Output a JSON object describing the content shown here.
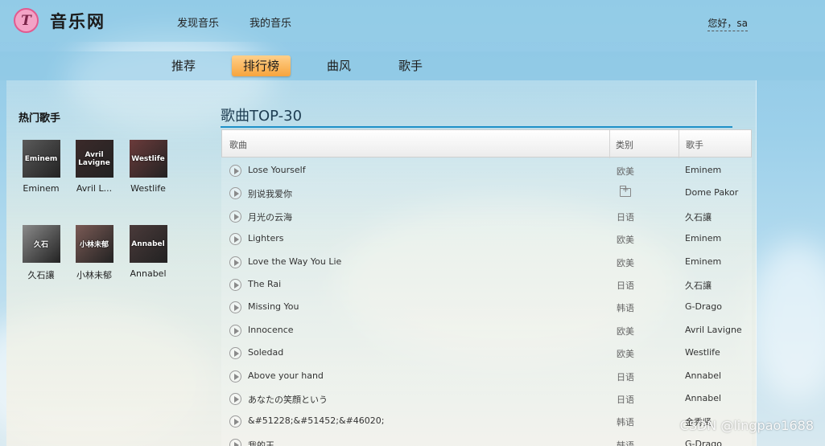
{
  "header": {
    "logo_letter": "T",
    "site_name": "音乐网",
    "nav": [
      "发现音乐",
      "我的音乐"
    ],
    "greeting": "您好，sa"
  },
  "subnav": {
    "items": [
      "推荐",
      "排行榜",
      "曲风",
      "歌手"
    ],
    "active": "排行榜"
  },
  "sidebar": {
    "title": "热门歌手",
    "singers": [
      {
        "name": "Eminem",
        "photo_text": "Eminem",
        "color": "#5a5a5a"
      },
      {
        "name": "Avril L...",
        "photo_text": "Avril Lavigne",
        "color": "#3b2a2a"
      },
      {
        "name": "Westlife",
        "photo_text": "Westlife",
        "color": "#6b3b3b"
      },
      {
        "name": "久石讓",
        "photo_text": "久石",
        "color": "#8a8a8a"
      },
      {
        "name": "小林未郁",
        "photo_text": "小林未郁",
        "color": "#7a5a55"
      },
      {
        "name": "Annabel",
        "photo_text": "Annabel",
        "color": "#4a3a3a"
      }
    ]
  },
  "list": {
    "title": "歌曲TOP-30",
    "headers": {
      "song": "歌曲",
      "category": "类别",
      "artist": "歌手"
    },
    "rows": [
      {
        "song": "Lose Yourself",
        "category": "欧美",
        "artist": "Eminem"
      },
      {
        "song": "别说我爱你",
        "category": "",
        "artist": "Dome Pakor",
        "category_icon": "folder-add-icon"
      },
      {
        "song": "月光の云海",
        "category": "日语",
        "artist": "久石讓"
      },
      {
        "song": "Lighters",
        "category": "欧美",
        "artist": "Eminem"
      },
      {
        "song": "Love the Way You Lie",
        "category": "欧美",
        "artist": "Eminem"
      },
      {
        "song": "The Rai",
        "category": "日语",
        "artist": "久石讓"
      },
      {
        "song": "Missing You",
        "category": "韩语",
        "artist": "G-Drago"
      },
      {
        "song": "Innocence",
        "category": "欧美",
        "artist": "Avril Lavigne"
      },
      {
        "song": "Soledad",
        "category": "欧美",
        "artist": "Westlife"
      },
      {
        "song": "Above your hand",
        "category": "日语",
        "artist": "Annabel"
      },
      {
        "song": "あなたの笑顔という",
        "category": "日语",
        "artist": "Annabel"
      },
      {
        "song": "&#51228;&#51452;&#46020;",
        "category": "韩语",
        "artist": "金秀贤"
      },
      {
        "song": "我的王",
        "category": "韩语",
        "artist": "G-Drago"
      }
    ]
  },
  "watermark": "CSDN @lingpao1688"
}
